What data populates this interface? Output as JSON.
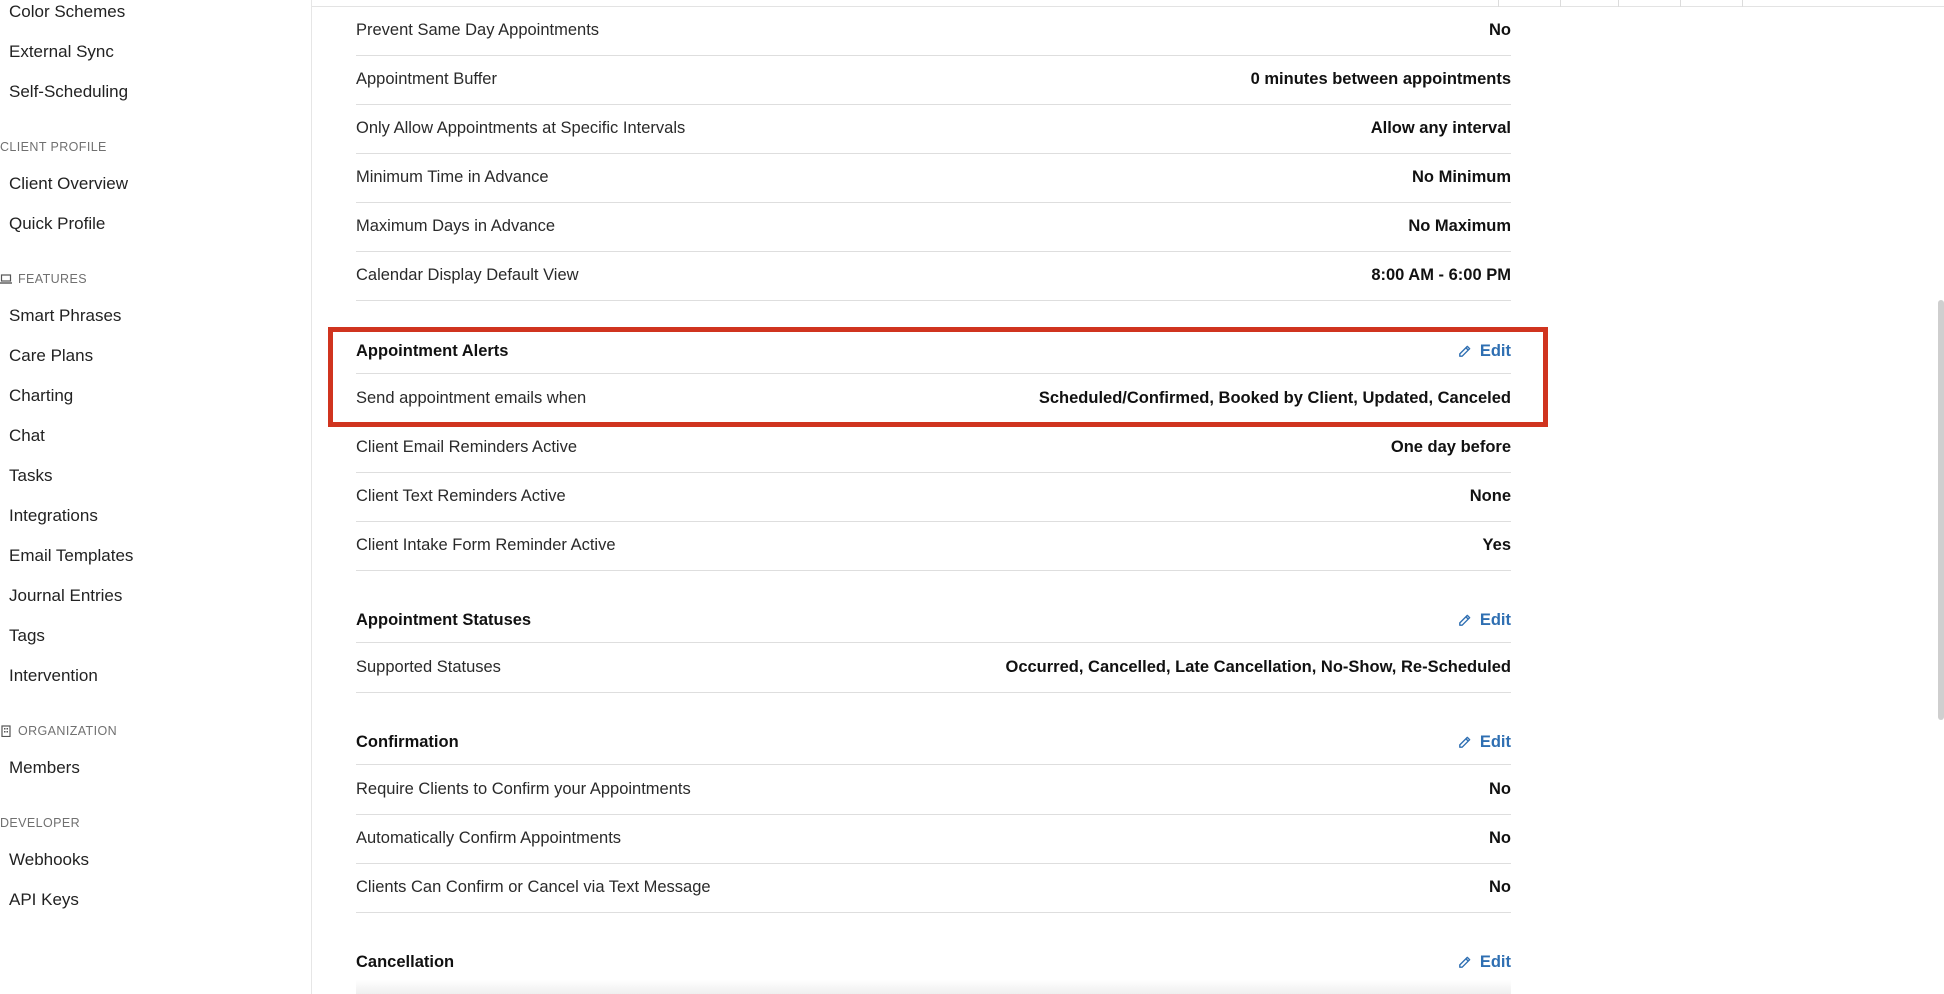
{
  "sidebar": {
    "items_top": [
      "Color Schemes",
      "External Sync",
      "Self-Scheduling"
    ],
    "client_profile": {
      "title": "CLIENT PROFILE",
      "items": [
        "Client Overview",
        "Quick Profile"
      ]
    },
    "features": {
      "title": "FEATURES",
      "icon": "laptop-icon",
      "items": [
        "Smart Phrases",
        "Care Plans",
        "Charting",
        "Chat",
        "Tasks",
        "Integrations",
        "Email Templates",
        "Journal Entries",
        "Tags",
        "Intervention"
      ]
    },
    "organization": {
      "title": "ORGANIZATION",
      "icon": "building-icon",
      "items": [
        "Members"
      ]
    },
    "developer": {
      "title": "DEVELOPER",
      "items": [
        "Webhooks",
        "API Keys"
      ]
    }
  },
  "scheduling_rows": [
    {
      "label": "Prevent Same Day Appointments",
      "value": "No"
    },
    {
      "label": "Appointment Buffer",
      "value": "0 minutes between appointments"
    },
    {
      "label": "Only Allow Appointments at Specific Intervals",
      "value": "Allow any interval"
    },
    {
      "label": "Minimum Time in Advance",
      "value": "No Minimum"
    },
    {
      "label": "Maximum Days in Advance",
      "value": "No Maximum"
    },
    {
      "label": "Calendar Display Default View",
      "value": "8:00 AM - 6:00 PM"
    }
  ],
  "appointment_alerts": {
    "title": "Appointment Alerts",
    "edit_label": "Edit",
    "rows": [
      {
        "label": "Send appointment emails when",
        "value": "Scheduled/Confirmed, Booked by Client, Updated, Canceled"
      },
      {
        "label": "Client Email Reminders Active",
        "value": "One day before"
      },
      {
        "label": "Client Text Reminders Active",
        "value": "None"
      },
      {
        "label": "Client Intake Form Reminder Active",
        "value": "Yes"
      }
    ]
  },
  "appointment_statuses": {
    "title": "Appointment Statuses",
    "edit_label": "Edit",
    "rows": [
      {
        "label": "Supported Statuses",
        "value": "Occurred, Cancelled, Late Cancellation, No-Show, Re-Scheduled"
      }
    ]
  },
  "confirmation": {
    "title": "Confirmation",
    "edit_label": "Edit",
    "rows": [
      {
        "label": "Require Clients to Confirm your Appointments",
        "value": "No"
      },
      {
        "label": "Automatically Confirm Appointments",
        "value": "No"
      },
      {
        "label": "Clients Can Confirm or Cancel via Text Message",
        "value": "No"
      }
    ]
  },
  "cancellation": {
    "title": "Cancellation",
    "edit_label": "Edit"
  },
  "colors": {
    "accent": "#2f6fb2",
    "highlight": "#d0341f"
  }
}
